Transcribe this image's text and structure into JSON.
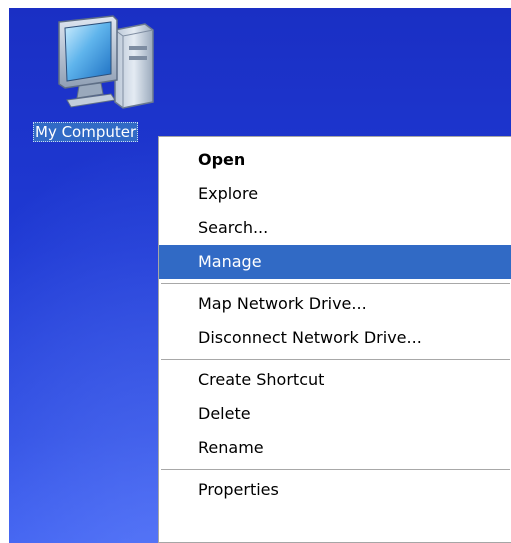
{
  "desktop": {
    "background_color": "#1f3ad4",
    "icon": {
      "label": "My Computer",
      "icon_name": "my-computer-icon",
      "selected": true
    }
  },
  "context_menu": {
    "highlight_color": "#316ac5",
    "groups": [
      [
        {
          "label": "Open",
          "bold": true
        },
        {
          "label": "Explore"
        },
        {
          "label": "Search..."
        },
        {
          "label": "Manage",
          "highlighted": true
        }
      ],
      [
        {
          "label": "Map Network Drive..."
        },
        {
          "label": "Disconnect Network Drive..."
        }
      ],
      [
        {
          "label": "Create Shortcut"
        },
        {
          "label": "Delete"
        },
        {
          "label": "Rename"
        }
      ],
      [
        {
          "label": "Properties"
        }
      ]
    ]
  }
}
